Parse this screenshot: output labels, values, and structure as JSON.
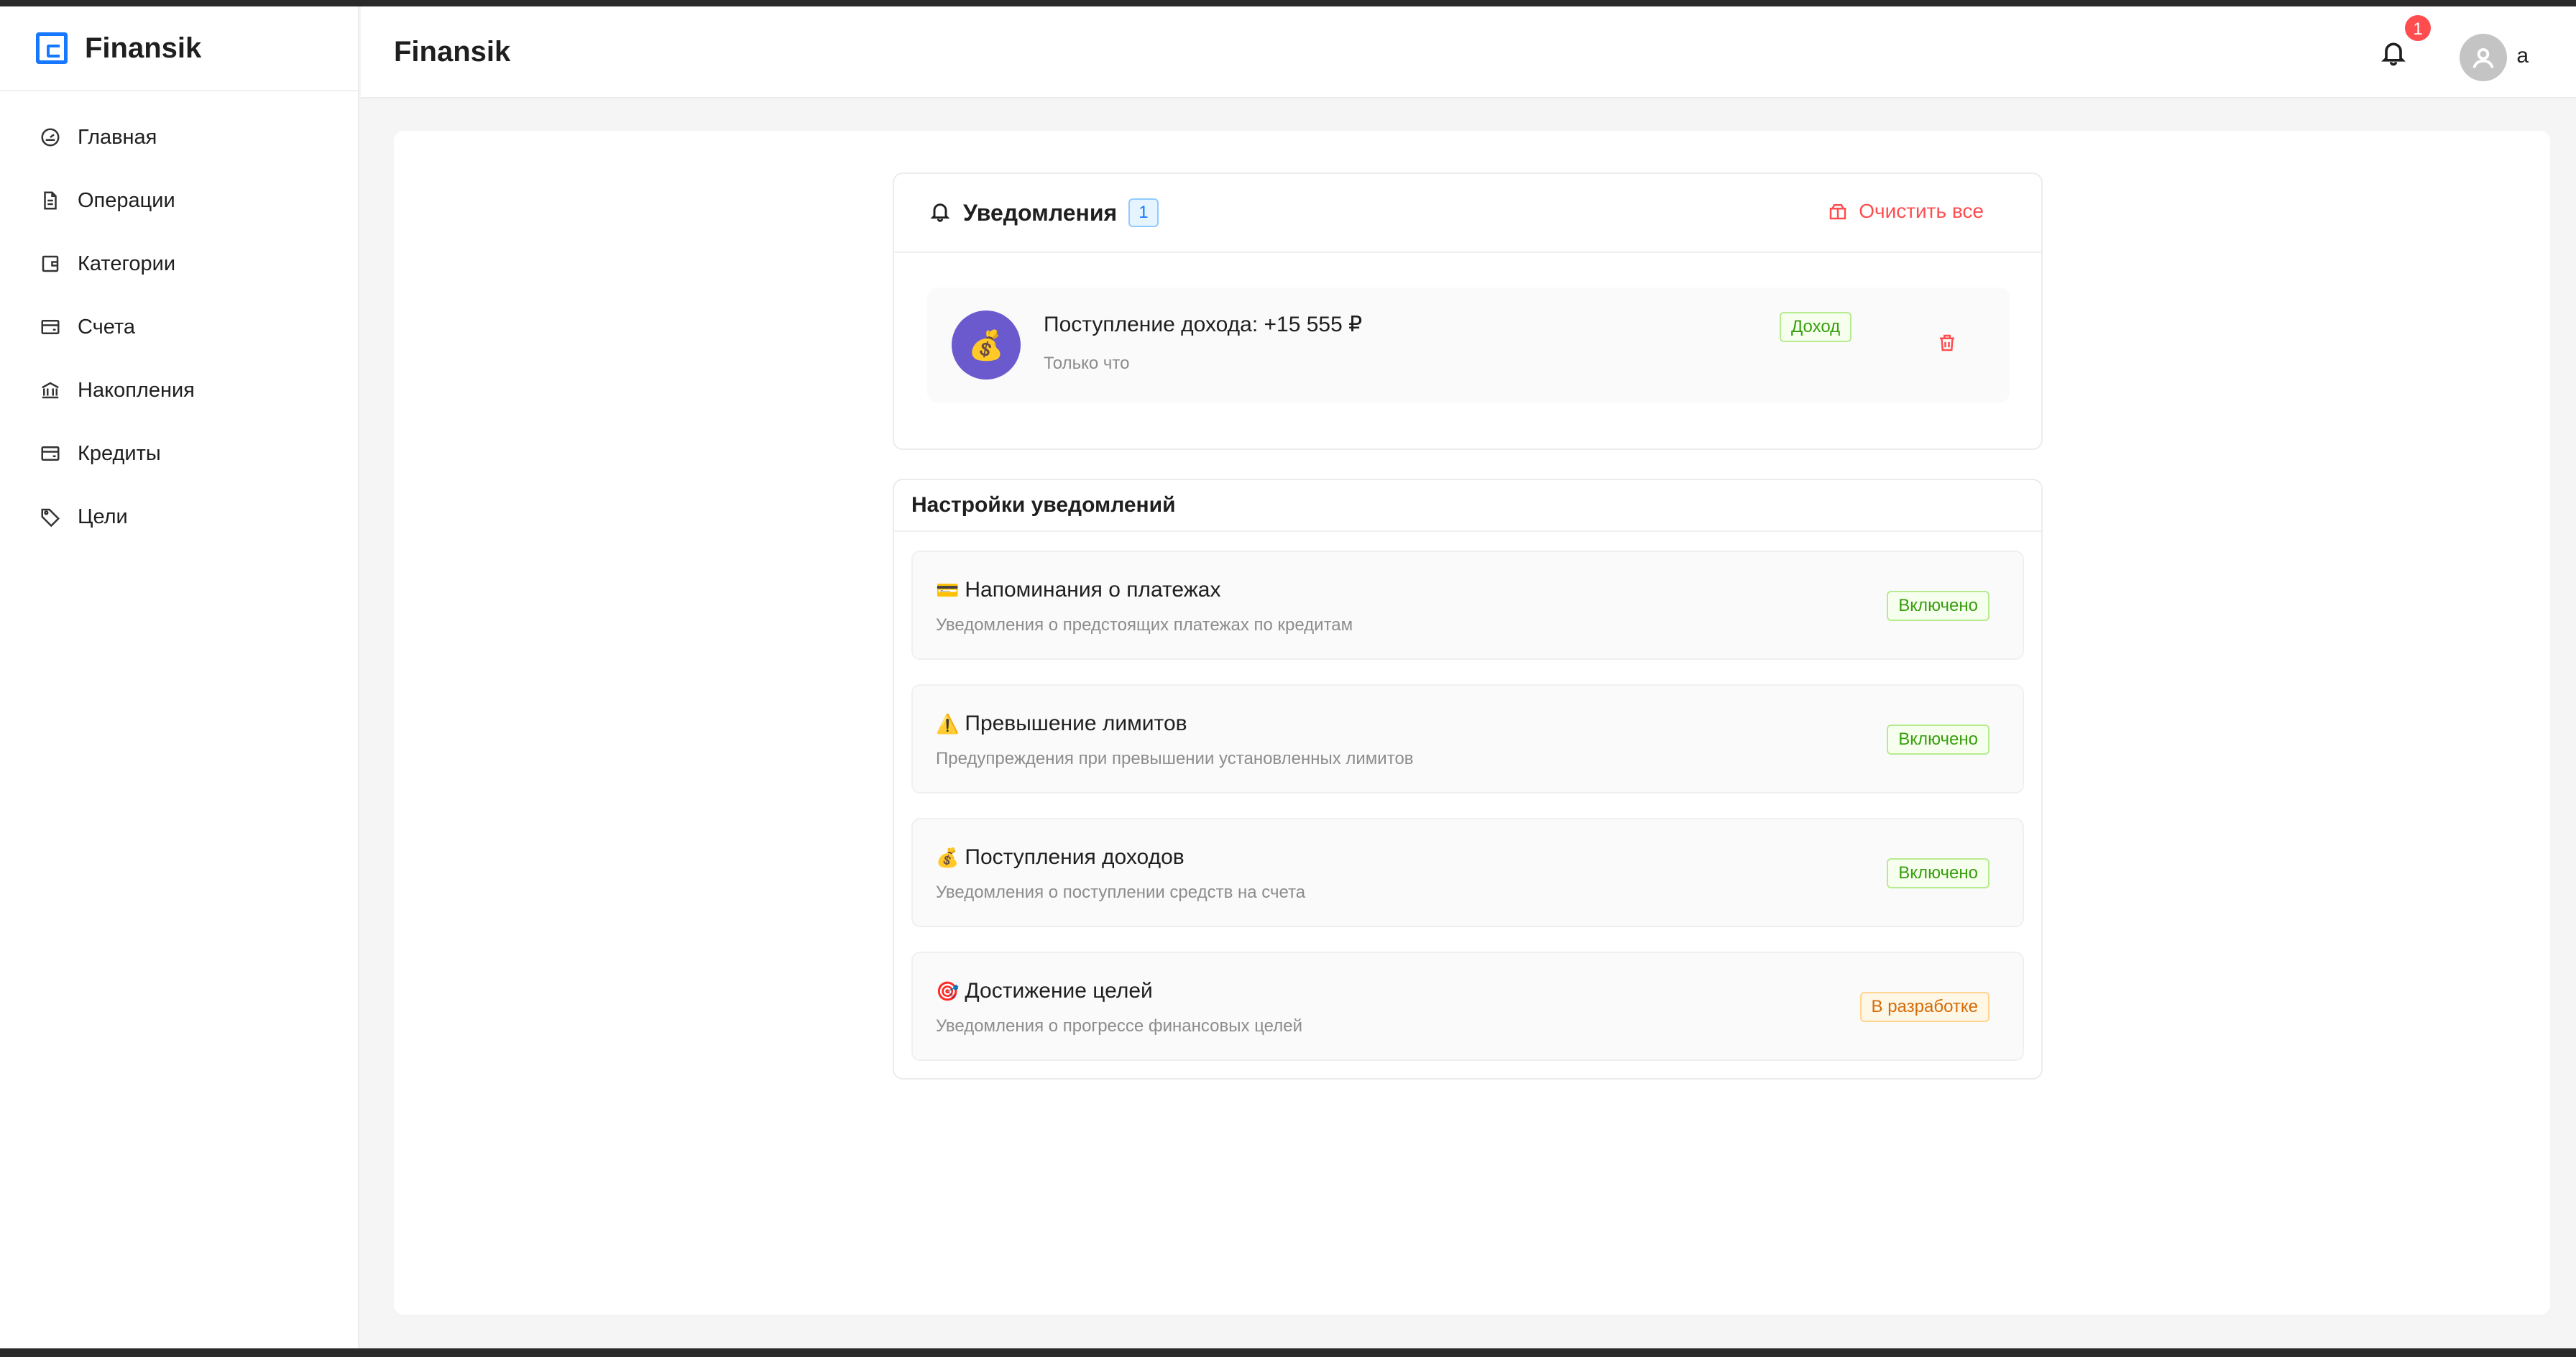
{
  "app": {
    "name": "Finansik"
  },
  "sidebar": {
    "items": [
      {
        "label": "Главная",
        "icon": "dashboard-icon"
      },
      {
        "label": "Операции",
        "icon": "file-icon"
      },
      {
        "label": "Категории",
        "icon": "wallet-icon"
      },
      {
        "label": "Счета",
        "icon": "credit-card-icon"
      },
      {
        "label": "Накопления",
        "icon": "bank-icon"
      },
      {
        "label": "Кредиты",
        "icon": "credit-card-icon"
      },
      {
        "label": "Цели",
        "icon": "tag-icon"
      }
    ]
  },
  "header": {
    "title": "Finansik",
    "notifications_count": "1",
    "user_name": "a"
  },
  "notifications": {
    "title": "Уведомления",
    "count": "1",
    "clear_label": "Очистить все",
    "items": [
      {
        "avatar_glyph": "💰",
        "text": "Поступление дохода: +15 555 ₽",
        "time": "Только что",
        "tag": "Доход"
      }
    ]
  },
  "settings": {
    "title": "Настройки уведомлений",
    "items": [
      {
        "icon": "💳",
        "title": "Напоминания о платежах",
        "desc": "Уведомления о предстоящих платежах по кредитам",
        "status": "Включено"
      },
      {
        "icon": "⚠️",
        "title": "Превышение лимитов",
        "desc": "Предупреждения при превышении установленных лимитов",
        "status": "Включено"
      },
      {
        "icon": "💰",
        "title": "Поступления доходов",
        "desc": "Уведомления о поступлении средств на счета",
        "status": "Включено"
      },
      {
        "icon": "🎯",
        "title": "Достижение целей",
        "desc": "Уведомления о прогрессе финансовых целей",
        "status": "В разработке"
      }
    ]
  },
  "colors": {
    "accent": "#1677ff",
    "danger": "#ff4d4f",
    "success": "#389e0d",
    "warning": "#d46b08"
  }
}
